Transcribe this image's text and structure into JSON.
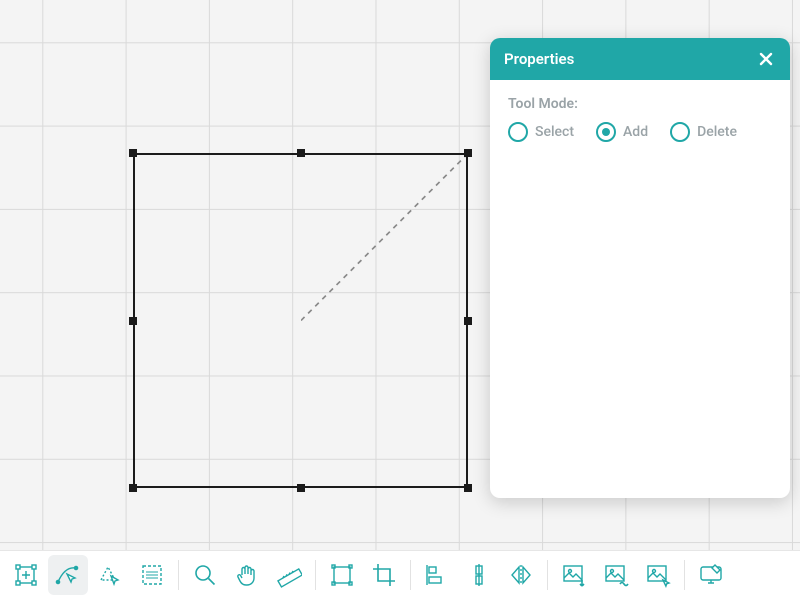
{
  "colors": {
    "teal": "#20a7a7"
  },
  "panel": {
    "title": "Properties",
    "tool_mode_label": "Tool Mode:",
    "options": [
      {
        "key": "select",
        "label": "Select",
        "selected": false
      },
      {
        "key": "add",
        "label": "Add",
        "selected": true
      },
      {
        "key": "delete",
        "label": "Delete",
        "selected": false
      }
    ]
  },
  "toolbar": {
    "items": [
      {
        "name": "select-transform-tool"
      },
      {
        "name": "node-edit-tool",
        "active": true
      },
      {
        "name": "lasso-select-tool"
      },
      {
        "name": "marquee-select-tool"
      },
      {
        "sep": true
      },
      {
        "name": "zoom-tool"
      },
      {
        "name": "pan-tool"
      },
      {
        "name": "ruler-tool"
      },
      {
        "sep": true
      },
      {
        "name": "bounding-box-tool"
      },
      {
        "name": "crop-tool"
      },
      {
        "sep": true
      },
      {
        "name": "align-distribute-tool"
      },
      {
        "name": "align-vertical-tool"
      },
      {
        "name": "mirror-horizontal-tool"
      },
      {
        "sep": true
      },
      {
        "name": "image-import-tool"
      },
      {
        "name": "image-trace-tool"
      },
      {
        "name": "image-export-tool"
      },
      {
        "sep": true
      },
      {
        "name": "screen-preview-tool"
      }
    ]
  }
}
